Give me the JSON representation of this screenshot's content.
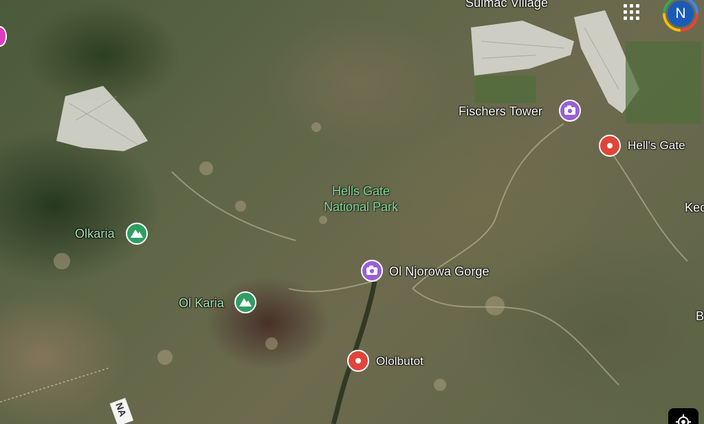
{
  "map": {
    "places": [
      {
        "id": "sulmac",
        "name": "Sulmac Village",
        "kind": "locality"
      },
      {
        "id": "fischers-tower",
        "name": "Fischers Tower",
        "kind": "attraction"
      },
      {
        "id": "hells-gate",
        "name": "Hell's Gate",
        "kind": "place"
      },
      {
        "id": "olkaria",
        "name": "Olkaria",
        "kind": "mountain"
      },
      {
        "id": "ol-njorowa",
        "name": "Ol Njorowa Gorge",
        "kind": "attraction"
      },
      {
        "id": "ol-karia",
        "name": "Ol Karia",
        "kind": "mountain"
      },
      {
        "id": "ololbutot",
        "name": "Ololbutot",
        "kind": "place"
      }
    ],
    "park_line1": "Hells Gate",
    "park_line2": "National Park",
    "edge_labels": {
      "right_top": "Kec",
      "right_mid": "B",
      "road": "NA"
    },
    "pin_colors": {
      "attraction": "#9a5fd6",
      "place": "#e0453a",
      "mountain": "#2f9e63"
    }
  },
  "header": {
    "apps_icon": "apps-grid-icon",
    "avatar_letter": "N",
    "avatar_color": "#1a5bb8"
  },
  "controls": {
    "locate_icon": "my-location-icon"
  }
}
